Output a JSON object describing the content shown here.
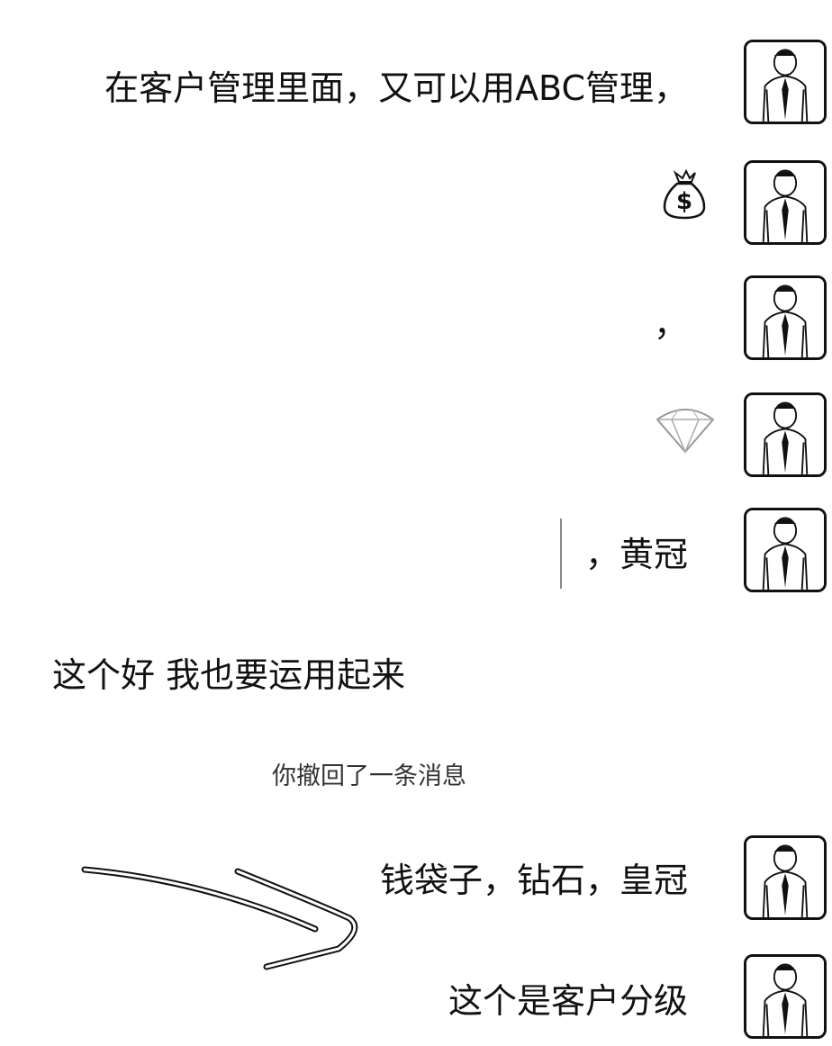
{
  "messages": [
    {
      "text": "在客户管理里面，又可以用ABC管理，"
    },
    {
      "icon": "money-bag-icon"
    },
    {
      "text": "，"
    },
    {
      "icon": "diamond-icon"
    },
    {
      "text": "，黄冠"
    }
  ],
  "incoming": {
    "text": "这个好  我也要运用起来"
  },
  "system": {
    "recall_notice": "你撤回了一条消息"
  },
  "later_messages": [
    {
      "text": "钱袋子，钻石，皇冠"
    },
    {
      "text": "这个是客户分级"
    }
  ]
}
